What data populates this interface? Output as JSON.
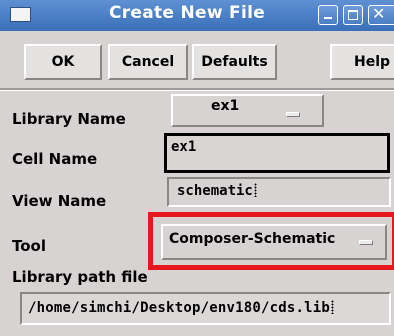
{
  "window": {
    "title": "Create New File",
    "controls": [
      "minimize-icon",
      "maximize-icon",
      "close-icon"
    ]
  },
  "toolbar": {
    "ok_label": "OK",
    "cancel_label": "Cancel",
    "defaults_label": "Defaults",
    "help_label": "Help"
  },
  "form": {
    "library_name": {
      "label": "Library Name",
      "value": "ex1"
    },
    "cell_name": {
      "label": "Cell Name",
      "value": "ex1"
    },
    "view_name": {
      "label": "View Name",
      "value": "schematic"
    },
    "tool": {
      "label": "Tool",
      "value": "Composer-Schematic"
    },
    "library_path": {
      "label": "Library path file",
      "value": "/home/simchi/Desktop/env180/cds.lib"
    }
  },
  "colors": {
    "titlebar": "#4a7ec4",
    "window_bg": "#d7d3d3",
    "highlight": "#e8171e"
  }
}
